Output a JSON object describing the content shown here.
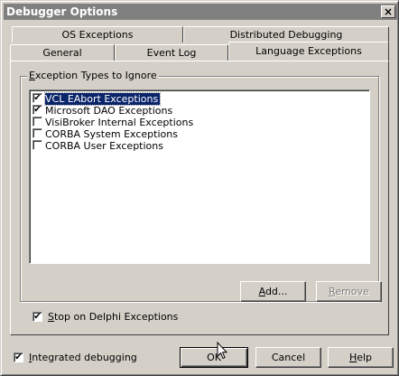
{
  "window": {
    "title": "Debugger Options",
    "close_glyph": "×"
  },
  "tabs": {
    "back_row": [
      "OS Exceptions",
      "Distributed Debugging"
    ],
    "front_row": [
      "General",
      "Event Log",
      "Language Exceptions"
    ],
    "active": "Language Exceptions"
  },
  "group": {
    "label_prefix": "",
    "label_access": "E",
    "label_rest": "xception Types to Ignore"
  },
  "exceptions": [
    {
      "label": "VCL EAbort Exceptions",
      "checked": true,
      "selected": true
    },
    {
      "label": "Microsoft DAO Exceptions",
      "checked": true,
      "selected": false
    },
    {
      "label": "VisiBroker Internal Exceptions",
      "checked": false,
      "selected": false
    },
    {
      "label": "CORBA System Exceptions",
      "checked": false,
      "selected": false
    },
    {
      "label": "CORBA User Exceptions",
      "checked": false,
      "selected": false
    }
  ],
  "list_buttons": {
    "add": {
      "access": "A",
      "rest": "dd..."
    },
    "remove": {
      "access": "R",
      "rest": "emove"
    }
  },
  "stop_on_delphi": {
    "checked": true,
    "access": "S",
    "rest": "top on Delphi Exceptions"
  },
  "integrated_debugging": {
    "checked": true,
    "access": "I",
    "rest": "ntegrated debugging"
  },
  "buttons": {
    "ok": "OK",
    "cancel": "Cancel",
    "help_access": "H",
    "help_rest": "elp"
  },
  "colors": {
    "face": "#d4d0c8",
    "selection": "#0a246a",
    "title_inactive": "#808080"
  }
}
